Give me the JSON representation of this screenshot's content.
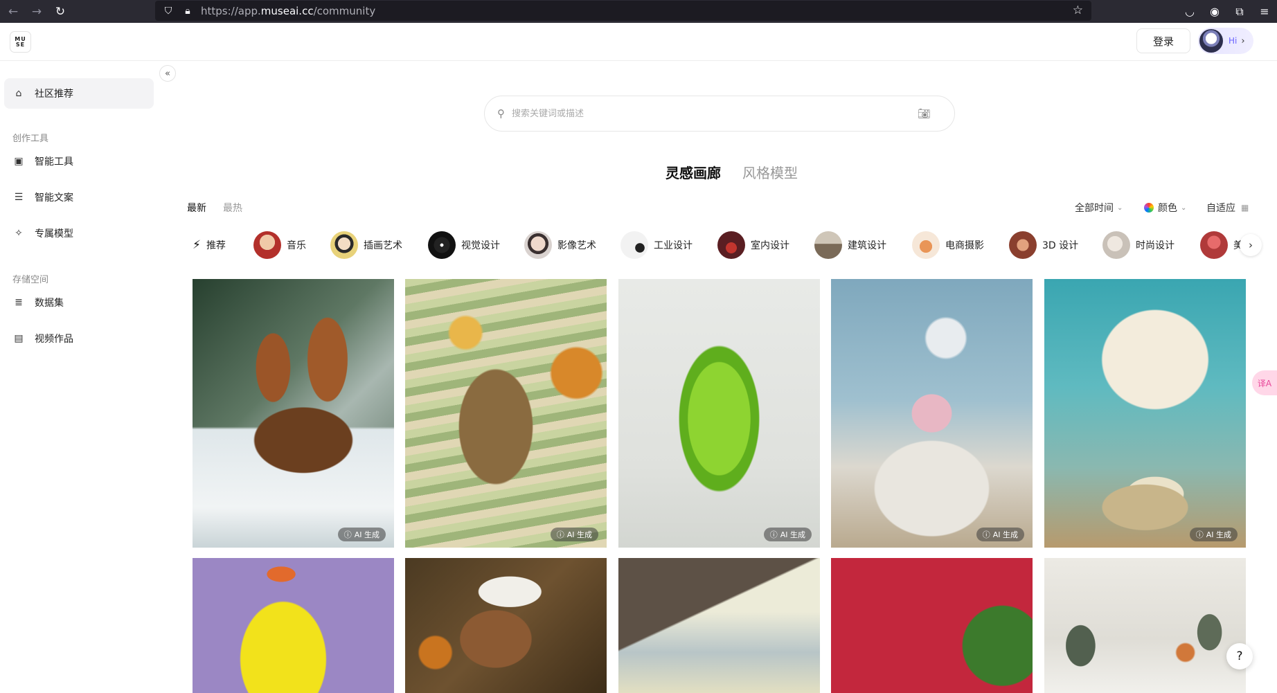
{
  "browser": {
    "url_prefix": "https://app.",
    "url_domain": "museai.cc",
    "url_path": "/community",
    "icons": [
      "back-icon",
      "forward-icon",
      "reload-icon",
      "shield-icon",
      "lock-icon",
      "star-icon",
      "pocket-icon",
      "account-icon",
      "extensions-icon",
      "menu-icon"
    ]
  },
  "header": {
    "logo_top": "MU",
    "logo_bottom": "SE",
    "login_label": "登录",
    "hi_label": "Hi",
    "hi_chevron": "›"
  },
  "sidebar": {
    "community": {
      "label": "社区推荐",
      "icon": "home-icon"
    },
    "creation_heading": "创作工具",
    "creation_items": [
      {
        "label": "智能工具",
        "icon": "image-icon"
      },
      {
        "label": "智能文案",
        "icon": "list-icon"
      },
      {
        "label": "专属模型",
        "icon": "magic-wand-icon"
      }
    ],
    "storage_heading": "存储空间",
    "storage_items": [
      {
        "label": "数据集",
        "icon": "database-icon"
      },
      {
        "label": "视频作品",
        "icon": "film-icon"
      }
    ],
    "collapse_glyph": "«"
  },
  "search": {
    "placeholder": "搜索关键词或描述"
  },
  "main_tabs": {
    "gallery": "灵感画廊",
    "style_models": "风格模型"
  },
  "sort": {
    "latest": "最新",
    "hottest": "最热"
  },
  "filters": {
    "time": "全部时间",
    "color": "颜色",
    "layout": "自适应"
  },
  "categories": [
    {
      "label": "推荐",
      "color": ""
    },
    {
      "label": "音乐",
      "color": "#b3302b"
    },
    {
      "label": "插画艺术",
      "color": "#e8d27a"
    },
    {
      "label": "视觉设计",
      "color": "#111111"
    },
    {
      "label": "影像艺术",
      "color": "#d9d2cf"
    },
    {
      "label": "工业设计",
      "color": "#f2f2f2"
    },
    {
      "label": "室内设计",
      "color": "#5a1e22"
    },
    {
      "label": "建筑设计",
      "color": "#7a6a58"
    },
    {
      "label": "电商摄影",
      "color": "#e99557"
    },
    {
      "label": "3D 设计",
      "color": "#8a3f2e"
    },
    {
      "label": "时尚设计",
      "color": "#c9c1b8"
    },
    {
      "label": "美",
      "color": "#b03a3a"
    }
  ],
  "gallery": {
    "badge_label": "AI 生成",
    "row1": [
      "treehouse-image",
      "wool-hiker-image",
      "cactus-chair-image",
      "perfume-image",
      "teacup-image"
    ],
    "row2": [
      "yellow-jacket-image",
      "squirrel-chef-image",
      "wood-sky-image",
      "red-leaf-image",
      "snow-forest-image"
    ]
  },
  "floating": {
    "translate_label": "译A",
    "help_label": "?"
  }
}
